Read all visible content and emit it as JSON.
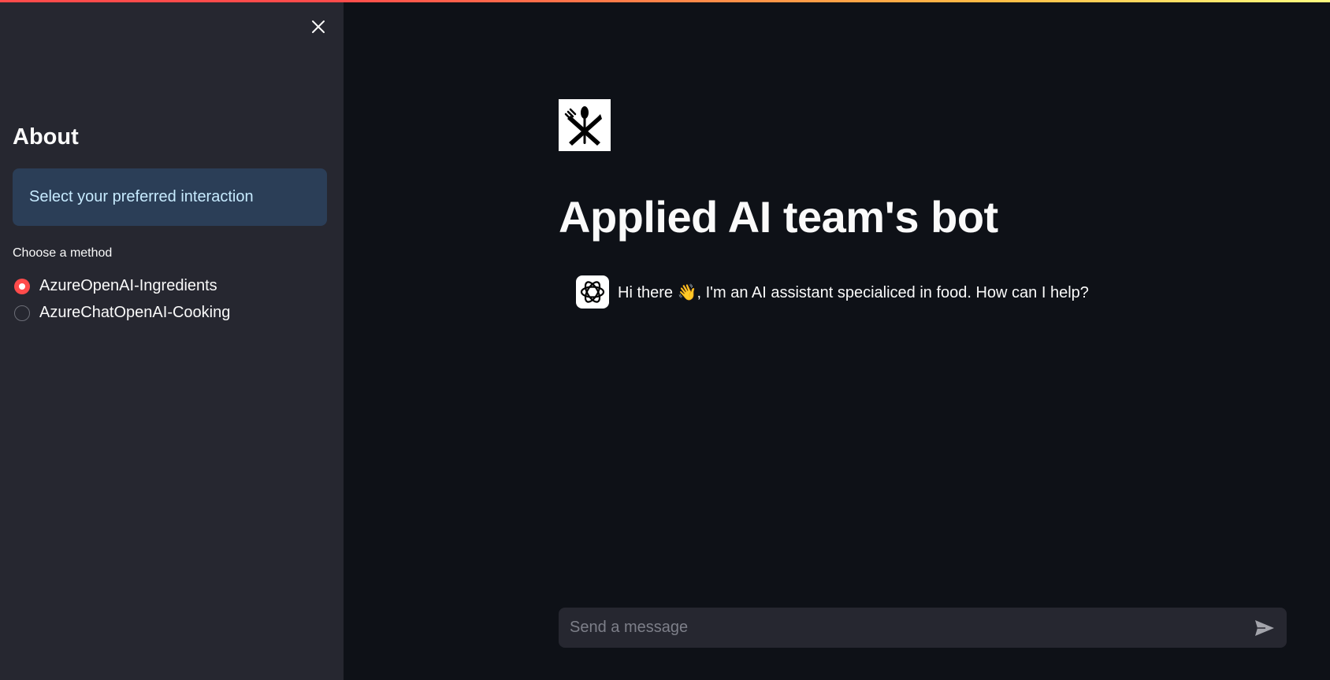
{
  "sidebar": {
    "close_icon": "close-icon",
    "about_title": "About",
    "info_text": "Select your preferred interaction",
    "radio_label": "Choose a method",
    "options": [
      {
        "label": "AzureOpenAI-Ingredients",
        "selected": true
      },
      {
        "label": "AzureChatOpenAI-Cooking",
        "selected": false
      }
    ]
  },
  "main": {
    "logo_icon": "fork-knife-spoon-icon",
    "title": "Applied AI team's bot",
    "messages": [
      {
        "role": "assistant",
        "avatar_icon": "openai-logo-icon",
        "text": "Hi there 👋, I'm an AI assistant specialiced in food. How can I help?"
      }
    ],
    "input": {
      "placeholder": "Send a message",
      "value": ""
    },
    "send_icon": "send-icon"
  },
  "colors": {
    "accent": "#ff4b4b",
    "background": "#0e1117",
    "sidebar": "#262730",
    "info_bg": "#2b3e57",
    "info_text": "#c7ebff"
  }
}
